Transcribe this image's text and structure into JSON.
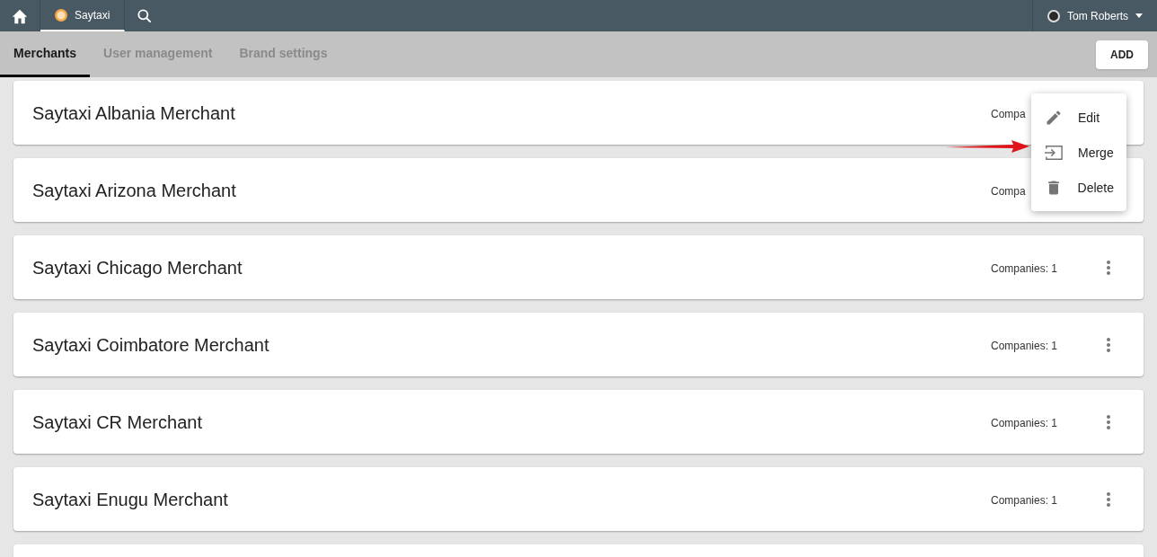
{
  "topbar": {
    "tabs": [
      {
        "kind": "home",
        "selected": false
      },
      {
        "kind": "brand",
        "label": "Saytaxi",
        "selected": true
      },
      {
        "kind": "search",
        "selected": false
      }
    ],
    "user": "Tom Roberts"
  },
  "tabs": [
    {
      "label": "Merchants",
      "selected": true
    },
    {
      "label": "User management",
      "selected": false
    },
    {
      "label": "Brand settings",
      "selected": false
    }
  ],
  "add_button": "ADD",
  "merchants": [
    {
      "name": "Saytaxi Albania Merchant",
      "companies": "Compa",
      "menu_button": false
    },
    {
      "name": "Saytaxi Arizona Merchant",
      "companies": "Compa",
      "menu_button": false
    },
    {
      "name": "Saytaxi Chicago Merchant",
      "companies": "Companies: 1",
      "menu_button": true
    },
    {
      "name": "Saytaxi Coimbatore Merchant",
      "companies": "Companies: 1",
      "menu_button": true
    },
    {
      "name": "Saytaxi CR Merchant",
      "companies": "Companies: 1",
      "menu_button": true
    },
    {
      "name": "Saytaxi Enugu Merchant",
      "companies": "Companies: 1",
      "menu_button": true
    }
  ],
  "menu": [
    {
      "kind": "edit",
      "label": "Edit"
    },
    {
      "kind": "merge",
      "label": "Merge"
    },
    {
      "kind": "delete",
      "label": "Delete"
    }
  ]
}
